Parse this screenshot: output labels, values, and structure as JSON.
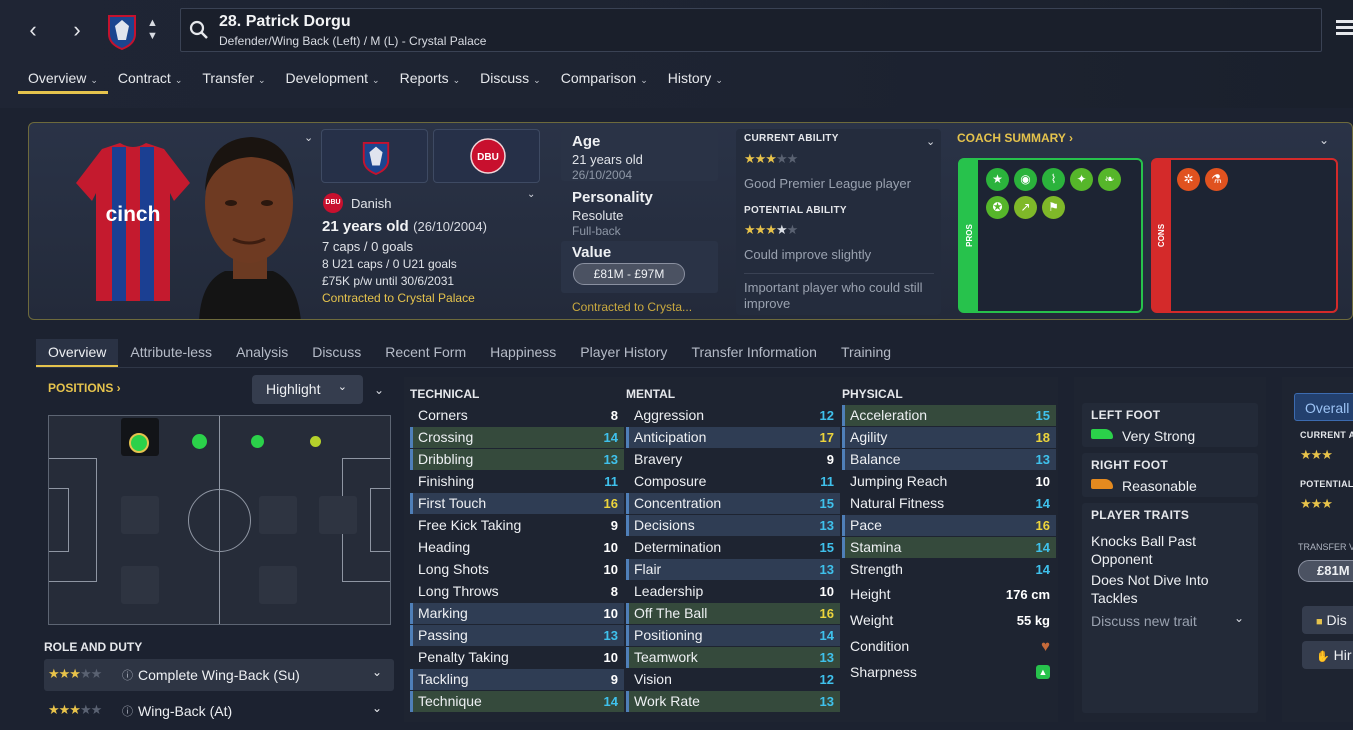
{
  "header": {
    "player_title": "28. Patrick Dorgu",
    "player_subtitle": "Defender/Wing Back (Left) / M (L) - Crystal Palace"
  },
  "nav": [
    "Overview",
    "Contract",
    "Transfer",
    "Development",
    "Reports",
    "Discuss",
    "Comparison",
    "History"
  ],
  "profile": {
    "shirt_sponsor": "cinch",
    "nation_badge": "DBU",
    "nationality": "Danish",
    "age_line": "21 years old",
    "dob_paren": "(26/10/2004)",
    "caps": "7 caps / 0 goals",
    "u21": "8 U21 caps / 0 U21 goals",
    "wage": "£75K p/w until 30/6/2031",
    "contract": "Contracted to Crystal Palace"
  },
  "info": {
    "age_label": "Age",
    "age": "21 years old",
    "dob": "26/10/2004",
    "personality_label": "Personality",
    "personality": "Resolute",
    "role_short": "Full-back",
    "value_label": "Value",
    "value": "£81M - £97M",
    "contract_short": "Contracted to Crysta..."
  },
  "ability": {
    "current_label": "CURRENT ABILITY",
    "current_desc": "Good Premier League player",
    "current_stars": 3,
    "potential_label": "POTENTIAL ABILITY",
    "potential_desc": "Could improve slightly",
    "potential_stars": 3.5,
    "note": "Important player who could still improve"
  },
  "coach": {
    "title": "COACH SUMMARY ›",
    "pros_label": "PROS",
    "cons_label": "CONS"
  },
  "subtabs": [
    "Overview",
    "Attribute-less",
    "Analysis",
    "Discuss",
    "Recent Form",
    "Happiness",
    "Player History",
    "Transfer Information",
    "Training"
  ],
  "positions": {
    "title": "POSITIONS ›",
    "highlight": "Highlight",
    "role_title": "ROLE AND DUTY",
    "roles": [
      {
        "name": "Complete Wing-Back (Su)",
        "stars": 3
      },
      {
        "name": "Wing-Back (At)",
        "stars": 3
      }
    ]
  },
  "attributes": {
    "technical_label": "TECHNICAL",
    "mental_label": "MENTAL",
    "physical_label": "PHYSICAL",
    "technical": [
      [
        "Corners",
        "8"
      ],
      [
        "Crossing",
        "14"
      ],
      [
        "Dribbling",
        "13"
      ],
      [
        "Finishing",
        "11"
      ],
      [
        "First Touch",
        "16"
      ],
      [
        "Free Kick Taking",
        "9"
      ],
      [
        "Heading",
        "10"
      ],
      [
        "Long Shots",
        "10"
      ],
      [
        "Long Throws",
        "8"
      ],
      [
        "Marking",
        "10"
      ],
      [
        "Passing",
        "13"
      ],
      [
        "Penalty Taking",
        "10"
      ],
      [
        "Tackling",
        "9"
      ],
      [
        "Technique",
        "14"
      ]
    ],
    "mental": [
      [
        "Aggression",
        "12"
      ],
      [
        "Anticipation",
        "17"
      ],
      [
        "Bravery",
        "9"
      ],
      [
        "Composure",
        "11"
      ],
      [
        "Concentration",
        "15"
      ],
      [
        "Decisions",
        "13"
      ],
      [
        "Determination",
        "15"
      ],
      [
        "Flair",
        "13"
      ],
      [
        "Leadership",
        "10"
      ],
      [
        "Off The Ball",
        "16"
      ],
      [
        "Positioning",
        "14"
      ],
      [
        "Teamwork",
        "13"
      ],
      [
        "Vision",
        "12"
      ],
      [
        "Work Rate",
        "13"
      ]
    ],
    "physical": [
      [
        "Acceleration",
        "15"
      ],
      [
        "Agility",
        "18"
      ],
      [
        "Balance",
        "13"
      ],
      [
        "Jumping Reach",
        "10"
      ],
      [
        "Natural Fitness",
        "14"
      ],
      [
        "Pace",
        "16"
      ],
      [
        "Stamina",
        "14"
      ],
      [
        "Strength",
        "14"
      ]
    ],
    "height_label": "Height",
    "height": "176 cm",
    "weight_label": "Weight",
    "weight": "55 kg",
    "condition_label": "Condition",
    "sharpness_label": "Sharpness"
  },
  "feet": {
    "left_label": "LEFT FOOT",
    "left": "Very Strong",
    "right_label": "RIGHT FOOT",
    "right": "Reasonable",
    "traits_label": "PLAYER TRAITS",
    "trait1": "Knocks Ball Past Opponent",
    "trait2": "Does Not Dive Into Tackles",
    "discuss": "Discuss new trait"
  },
  "right": {
    "overall": "Overall",
    "current": "CURRENT A",
    "potential": "POTENTIAL",
    "transfer": "TRANSFER V",
    "value": "£81M",
    "btn1": "Dis",
    "btn2": "Hir"
  },
  "colors": {
    "accent": "#e5c34d",
    "pros": "#27c24c",
    "cons": "#d42a2a",
    "cyan": "#3fc1ec",
    "yellow": "#ecd43c"
  }
}
